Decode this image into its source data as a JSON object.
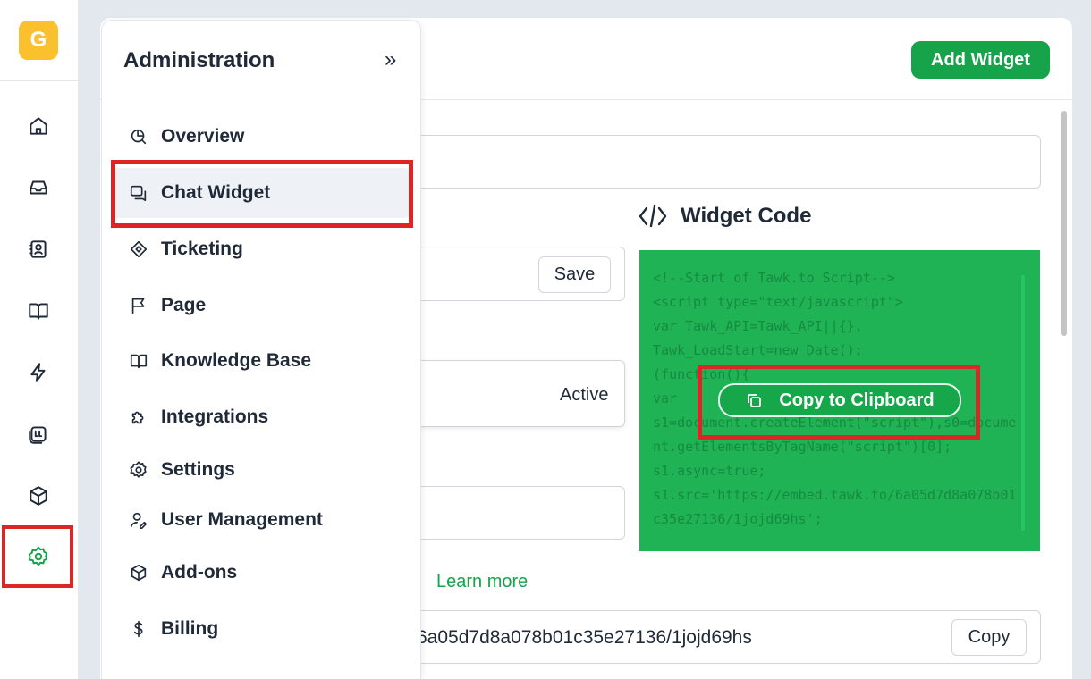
{
  "app": {
    "logo_letter": "G"
  },
  "rail": {
    "items": [
      {
        "icon": "home-icon"
      },
      {
        "icon": "inbox-icon"
      },
      {
        "icon": "contacts-icon"
      },
      {
        "icon": "book-icon"
      },
      {
        "icon": "lightning-icon"
      },
      {
        "icon": "chat-bubble-icon"
      },
      {
        "icon": "cube-icon"
      },
      {
        "icon": "gear-icon",
        "active": true
      }
    ]
  },
  "admin": {
    "title": "Administration",
    "collapse_glyph": "»",
    "items": [
      {
        "label": "Overview",
        "icon": "overview-icon"
      },
      {
        "label": "Chat Widget",
        "icon": "chat-widget-icon",
        "active": true
      },
      {
        "label": "Ticketing",
        "icon": "ticket-icon"
      },
      {
        "label": "Page",
        "icon": "flag-icon"
      },
      {
        "label": "Knowledge Base",
        "icon": "book-icon"
      },
      {
        "label": "Integrations",
        "icon": "puzzle-icon"
      },
      {
        "label": "Settings",
        "icon": "gear-icon"
      },
      {
        "label": "User Management",
        "icon": "user-icon"
      },
      {
        "label": "Add-ons",
        "icon": "cube-icon"
      },
      {
        "label": "Billing",
        "icon": "dollar-icon"
      }
    ]
  },
  "header": {
    "add_widget_label": "Add Widget"
  },
  "content": {
    "save_label": "Save",
    "status_value": "Active",
    "widget_code_title": "Widget Code",
    "code_text": "<!--Start of Tawk.to Script-->\n<script type=\"text/javascript\">\nvar Tawk_API=Tawk_API||{},\nTawk_LoadStart=new Date();\n(function(){\nvar\ns1=document.createElement(\"script\"),s0=document.getElementsByTagName(\"script\")[0];\ns1.async=true;\ns1.src='https://embed.tawk.to/6a05d7d8a078b01c35e27136/1jojd69hs';",
    "copy_clipboard_label": "Copy to Clipboard",
    "learn_more_label": "Learn more",
    "direct_link_text": "6a05d7d8a078b01c35e27136/1jojd69hs",
    "copy_label": "Copy"
  },
  "colors": {
    "accent": "#16a34a",
    "highlight": "#dc2626",
    "logo": "#fbc02d"
  }
}
